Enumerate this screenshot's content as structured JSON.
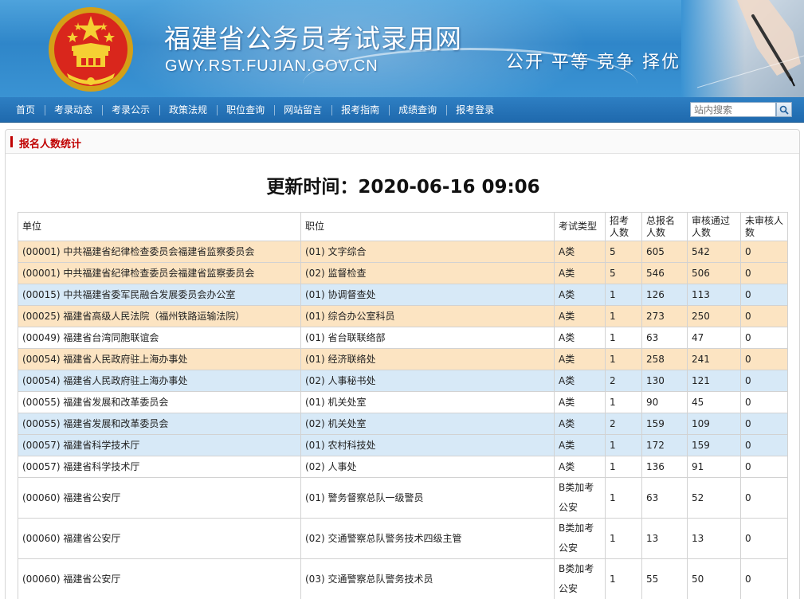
{
  "header": {
    "site_title": "福建省公务员考试录用网",
    "site_url": "GWY.RST.FUJIAN.GOV.CN",
    "slogan": "公开 平等 竞争 择优"
  },
  "nav": {
    "items": [
      "首页",
      "考录动态",
      "考录公示",
      "政策法规",
      "职位查询",
      "网站留言",
      "报考指南",
      "成绩查询",
      "报考登录"
    ],
    "search_placeholder": "站内搜索"
  },
  "panel": {
    "title": "报名人数统计",
    "update_time": "更新时间：2020-06-16 09:06"
  },
  "table": {
    "headers": [
      "单位",
      "职位",
      "考试类型",
      "招考人数",
      "总报名人数",
      "审核通过人数",
      "未审核人数"
    ],
    "rows": [
      {
        "unit": "(00001) 中共福建省纪律检查委员会福建省监察委员会",
        "position": "(01) 文字综合",
        "type": "A类",
        "recruit": "5",
        "total": "605",
        "passed": "542",
        "pending": "0",
        "style": "orange"
      },
      {
        "unit": "(00001) 中共福建省纪律检查委员会福建省监察委员会",
        "position": "(02) 监督检查",
        "type": "A类",
        "recruit": "5",
        "total": "546",
        "passed": "506",
        "pending": "0",
        "style": "orange"
      },
      {
        "unit": "(00015) 中共福建省委军民融合发展委员会办公室",
        "position": "(01) 协调督查处",
        "type": "A类",
        "recruit": "1",
        "total": "126",
        "passed": "113",
        "pending": "0",
        "style": "blue"
      },
      {
        "unit": "(00025) 福建省高级人民法院（福州铁路运输法院）",
        "position": "(01) 综合办公室科员",
        "type": "A类",
        "recruit": "1",
        "total": "273",
        "passed": "250",
        "pending": "0",
        "style": "orange"
      },
      {
        "unit": "(00049) 福建省台湾同胞联谊会",
        "position": "(01) 省台联联络部",
        "type": "A类",
        "recruit": "1",
        "total": "63",
        "passed": "47",
        "pending": "0",
        "style": "white"
      },
      {
        "unit": "(00054) 福建省人民政府驻上海办事处",
        "position": "(01) 经济联络处",
        "type": "A类",
        "recruit": "1",
        "total": "258",
        "passed": "241",
        "pending": "0",
        "style": "orange"
      },
      {
        "unit": "(00054) 福建省人民政府驻上海办事处",
        "position": "(02) 人事秘书处",
        "type": "A类",
        "recruit": "2",
        "total": "130",
        "passed": "121",
        "pending": "0",
        "style": "blue"
      },
      {
        "unit": "(00055) 福建省发展和改革委员会",
        "position": "(01) 机关处室",
        "type": "A类",
        "recruit": "1",
        "total": "90",
        "passed": "45",
        "pending": "0",
        "style": "white"
      },
      {
        "unit": "(00055) 福建省发展和改革委员会",
        "position": "(02) 机关处室",
        "type": "A类",
        "recruit": "2",
        "total": "159",
        "passed": "109",
        "pending": "0",
        "style": "blue"
      },
      {
        "unit": "(00057) 福建省科学技术厅",
        "position": "(01) 农村科技处",
        "type": "A类",
        "recruit": "1",
        "total": "172",
        "passed": "159",
        "pending": "0",
        "style": "blue"
      },
      {
        "unit": "(00057) 福建省科学技术厅",
        "position": "(02) 人事处",
        "type": "A类",
        "recruit": "1",
        "total": "136",
        "passed": "91",
        "pending": "0",
        "style": "white"
      },
      {
        "unit": "(00060) 福建省公安厅",
        "position": "(01) 警务督察总队一级警员",
        "type": "B类加考公安",
        "recruit": "1",
        "total": "63",
        "passed": "52",
        "pending": "0",
        "style": "white",
        "tall": true
      },
      {
        "unit": "(00060) 福建省公安厅",
        "position": "(02) 交通警察总队警务技术四级主管",
        "type": "B类加考公安",
        "recruit": "1",
        "total": "13",
        "passed": "13",
        "pending": "0",
        "style": "white",
        "tall": true
      },
      {
        "unit": "(00060) 福建省公安厅",
        "position": "(03) 交通警察总队警务技术员",
        "type": "B类加考公安",
        "recruit": "1",
        "total": "55",
        "passed": "50",
        "pending": "0",
        "style": "white",
        "tall": true
      }
    ]
  },
  "colors": {
    "banner_blue": "#3a93d3",
    "nav_blue": "#1f69ad",
    "title_red": "#c00000",
    "row_orange": "#fce4c2",
    "row_blue": "#d7e9f7"
  }
}
